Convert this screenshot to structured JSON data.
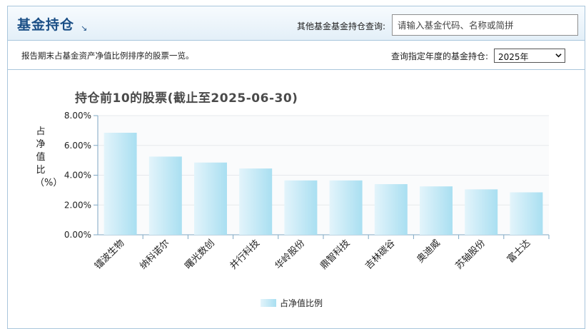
{
  "header": {
    "title": "基金持仓",
    "arrow_glyph": "↘"
  },
  "other_search": {
    "label": "其他基金基金持仓查询:",
    "placeholder": "请输入基金代码、名称或简拼"
  },
  "subbar": {
    "description": "报告期末占基金资产净值比例排序的股票一览。",
    "year_label": "查询指定年度的基金持仓:",
    "year_selected": "2025年"
  },
  "chart_data": {
    "type": "bar",
    "title": "持仓前10的股票(截止至2025-06-30)",
    "ylabel": "占净值比（%）",
    "ylim": [
      0,
      8
    ],
    "yticks": [
      "0.00%",
      "2.00%",
      "4.00%",
      "6.00%",
      "8.00%"
    ],
    "categories": [
      "镭波生物",
      "纳科诺尔",
      "曙光数创",
      "并行科技",
      "华岭股份",
      "鼎智科技",
      "吉林碳谷",
      "奥迪威",
      "苏轴股份",
      "富士达"
    ],
    "series": [
      {
        "name": "占净值比例",
        "values": [
          6.85,
          5.25,
          4.85,
          4.45,
          3.65,
          3.65,
          3.4,
          3.25,
          3.05,
          2.85
        ]
      }
    ],
    "legend_position": "bottom",
    "grid": true,
    "colors": {
      "bar_light": "#e3f4fb",
      "bar_dark": "#a9dff1",
      "axis": "#7fa7c3"
    }
  }
}
